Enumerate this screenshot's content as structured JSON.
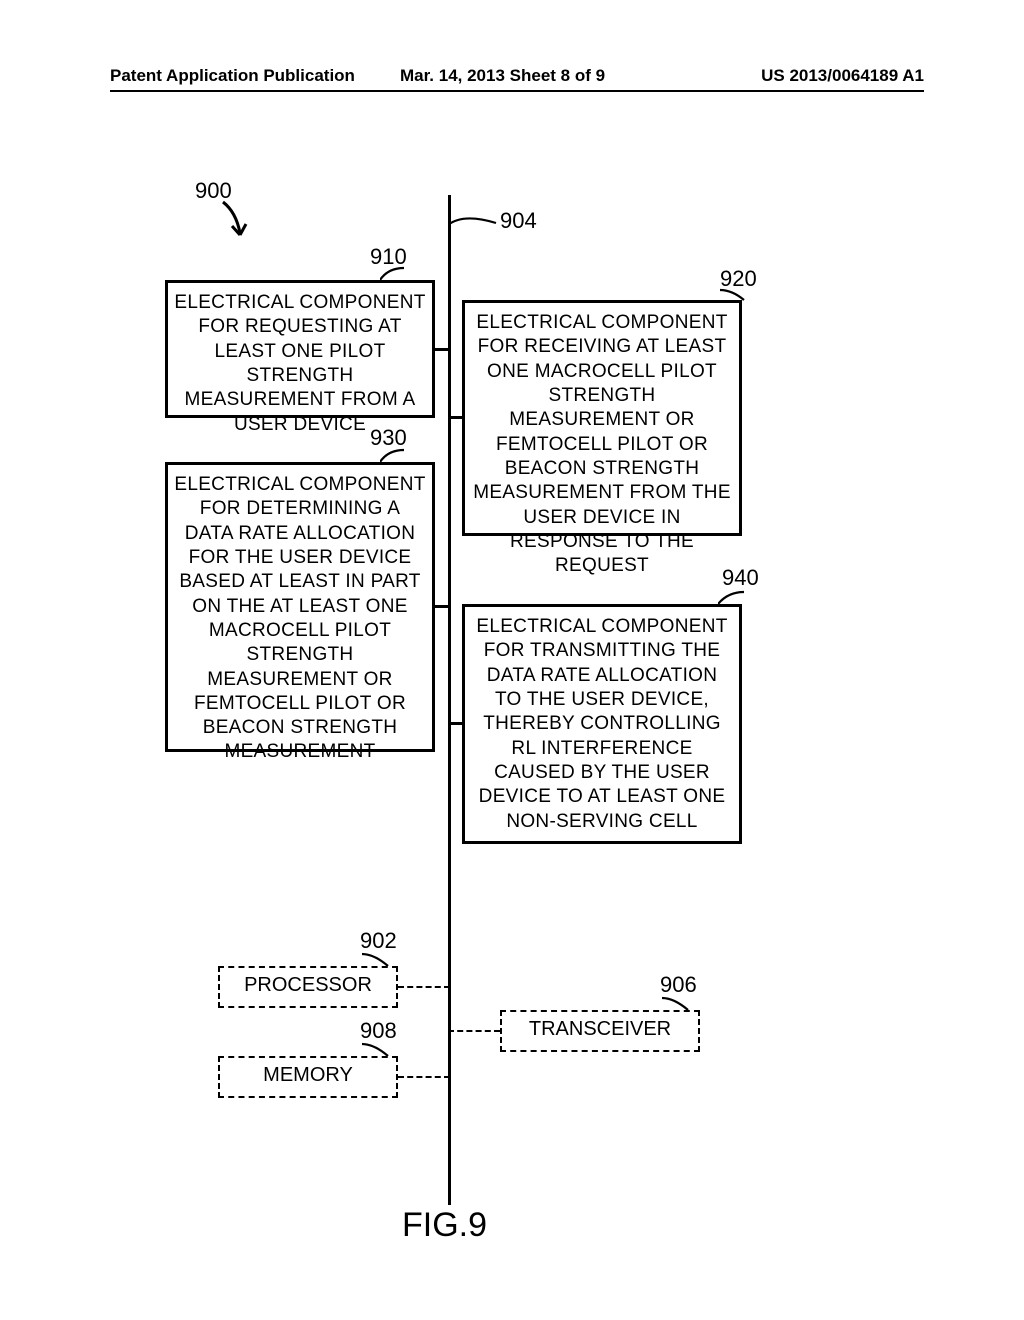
{
  "header": {
    "left": "Patent Application Publication",
    "middle": "Mar. 14, 2013  Sheet 8 of 9",
    "right": "US 2013/0064189 A1"
  },
  "refs": {
    "r900": "900",
    "r904": "904",
    "r910": "910",
    "r920": "920",
    "r930": "930",
    "r940": "940",
    "r902": "902",
    "r906": "906",
    "r908": "908"
  },
  "boxes": {
    "b910": "ELECTRICAL COMPONENT FOR REQUESTING AT LEAST ONE PILOT STRENGTH MEASUREMENT FROM A USER DEVICE",
    "b920": "ELECTRICAL COMPONENT FOR RECEIVING AT LEAST ONE MACROCELL PILOT STRENGTH MEASUREMENT OR FEMTOCELL PILOT OR BEACON STRENGTH MEASUREMENT FROM THE USER DEVICE IN RESPONSE TO THE REQUEST",
    "b930": "ELECTRICAL COMPONENT FOR DETERMINING A DATA RATE ALLOCATION FOR THE USER DEVICE BASED AT LEAST IN PART ON THE AT LEAST ONE MACROCELL PILOT STRENGTH MEASUREMENT OR FEMTOCELL PILOT OR BEACON STRENGTH MEASUREMENT",
    "b940": "ELECTRICAL COMPONENT FOR TRANSMITTING THE DATA RATE ALLOCATION TO THE USER DEVICE, THEREBY CONTROLLING RL INTERFERENCE CAUSED BY THE USER DEVICE TO AT LEAST ONE NON-SERVING CELL",
    "processor": "PROCESSOR",
    "transceiver": "TRANSCEIVER",
    "memory": "MEMORY"
  },
  "figure_label": "FIG.9"
}
